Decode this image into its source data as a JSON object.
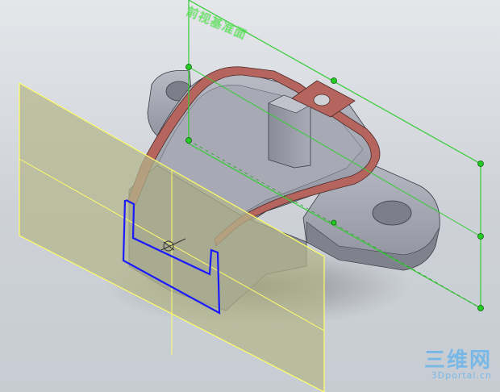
{
  "viewport": {
    "plane_label": "前视基准面",
    "selected_sketch": "blue-profile"
  },
  "watermark": {
    "brand": "三维网",
    "site": "3Dportal.cn"
  },
  "colors": {
    "background_top": "#e4e6ea",
    "background_bottom": "#c7ccd3",
    "part_body": "#9ea1ad",
    "section_face": "#b5655d",
    "plane_fill": "#b4b58c",
    "plane_edge": "#ffff66",
    "green_plane": "#33cc33",
    "sketch_blue": "#1a1aff"
  }
}
